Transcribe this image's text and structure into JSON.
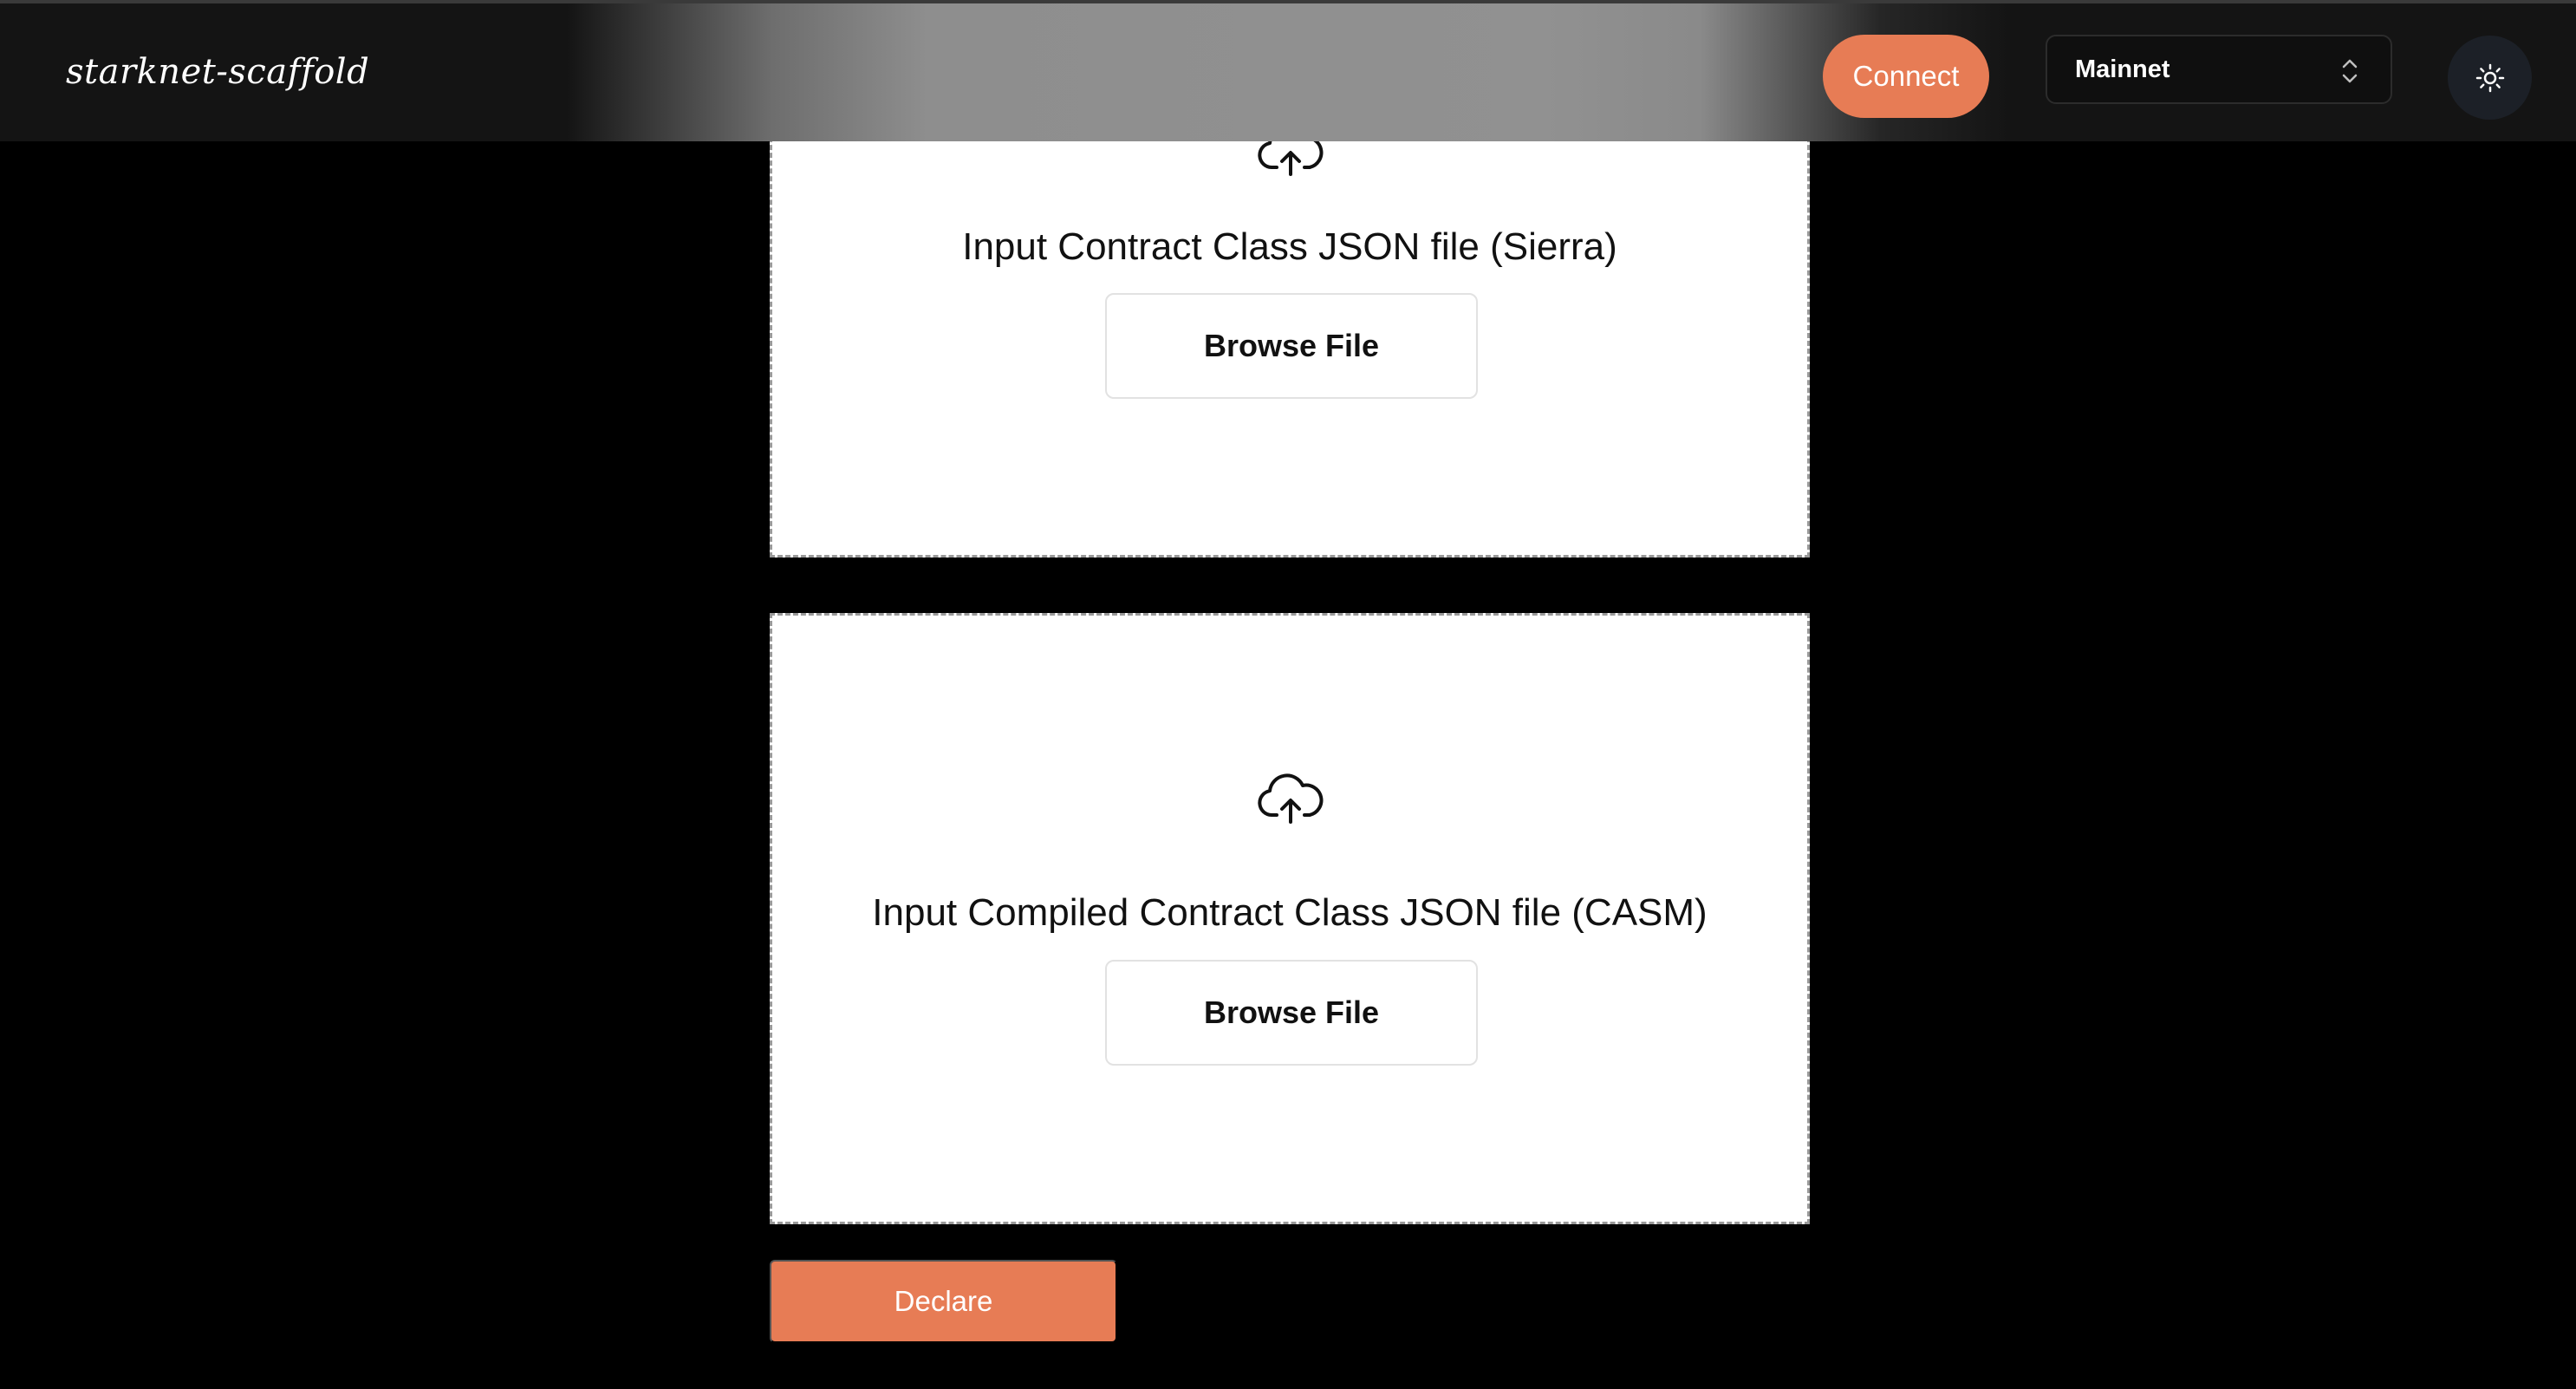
{
  "header": {
    "logo": "starknet-scaffold",
    "connect_label": "Connect",
    "network": {
      "selected": "Mainnet"
    },
    "theme_icon": "sun-icon"
  },
  "uploads": [
    {
      "title": "Input Contract Class JSON file (Sierra)",
      "button_label": "Browse File",
      "icon": "cloud-upload-icon"
    },
    {
      "title": "Input Compiled Contract Class JSON file (CASM)",
      "button_label": "Browse File",
      "icon": "cloud-upload-icon"
    }
  ],
  "declare_label": "Declare",
  "colors": {
    "accent": "#e77c55",
    "background": "#000000",
    "panel": "#ffffff"
  }
}
